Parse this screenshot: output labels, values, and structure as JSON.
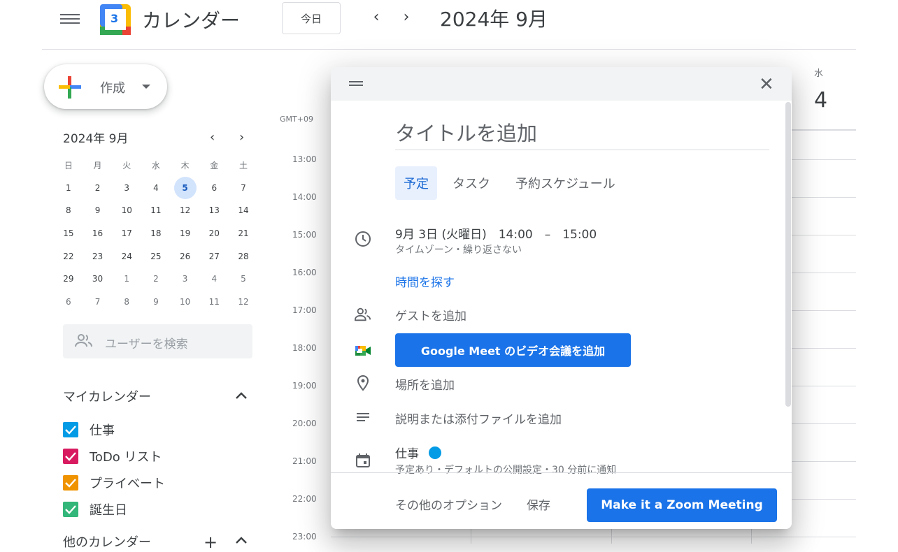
{
  "header": {
    "app_title": "カレンダー",
    "logo_day": "3",
    "today_label": "今日",
    "prev_label": "‹",
    "next_label": "›",
    "period": "2024年 9月"
  },
  "sidebar": {
    "create_label": "作成",
    "mini_cal": {
      "title": "2024年 9月",
      "weekdays": [
        "日",
        "月",
        "火",
        "水",
        "木",
        "金",
        "土"
      ],
      "weeks": [
        [
          "1",
          "2",
          "3",
          "4",
          "5",
          "6",
          "7"
        ],
        [
          "8",
          "9",
          "10",
          "11",
          "12",
          "13",
          "14"
        ],
        [
          "15",
          "16",
          "17",
          "18",
          "19",
          "20",
          "21"
        ],
        [
          "22",
          "23",
          "24",
          "25",
          "26",
          "27",
          "28"
        ],
        [
          "29",
          "30",
          "1",
          "2",
          "3",
          "4",
          "5"
        ],
        [
          "6",
          "7",
          "8",
          "9",
          "10",
          "11",
          "12"
        ]
      ],
      "today": "5"
    },
    "search_users_placeholder": "ユーザーを検索",
    "my_calendars_title": "マイカレンダー",
    "my_calendars": [
      {
        "label": "仕事",
        "color": "#039be5"
      },
      {
        "label": "ToDo リスト",
        "color": "#d81b60"
      },
      {
        "label": "プライベート",
        "color": "#f09300"
      },
      {
        "label": "誕生日",
        "color": "#33b679"
      }
    ],
    "other_calendars_title": "他のカレンダー"
  },
  "grid": {
    "timezone": "GMT+09",
    "hours": [
      "13:00",
      "14:00",
      "15:00",
      "16:00",
      "17:00",
      "18:00",
      "19:00",
      "20:00",
      "21:00",
      "22:00",
      "23:00"
    ],
    "visible_day": {
      "weekday": "水",
      "date": "4"
    }
  },
  "dialog": {
    "title_placeholder": "タイトルを追加",
    "tabs": [
      "予定",
      "タスク",
      "予約スケジュール"
    ],
    "datetime": "9月 3日 (火曜日)　14:00　–　15:00",
    "datetime_sub": "タイムゾーン・繰り返さない",
    "find_time": "時間を探す",
    "add_guests": "ゲストを追加",
    "meet_button": "Google Meet のビデオ会議を追加",
    "add_location": "場所を追加",
    "add_description": "説明または添付ファイルを追加",
    "calendar_name": "仕事",
    "calendar_color": "#039be5",
    "calendar_sub": "予定あり・デフォルトの公開設定・30 分前に通知",
    "more_options": "その他のオプション",
    "save": "保存",
    "zoom_button": "Make it a Zoom Meeting"
  }
}
